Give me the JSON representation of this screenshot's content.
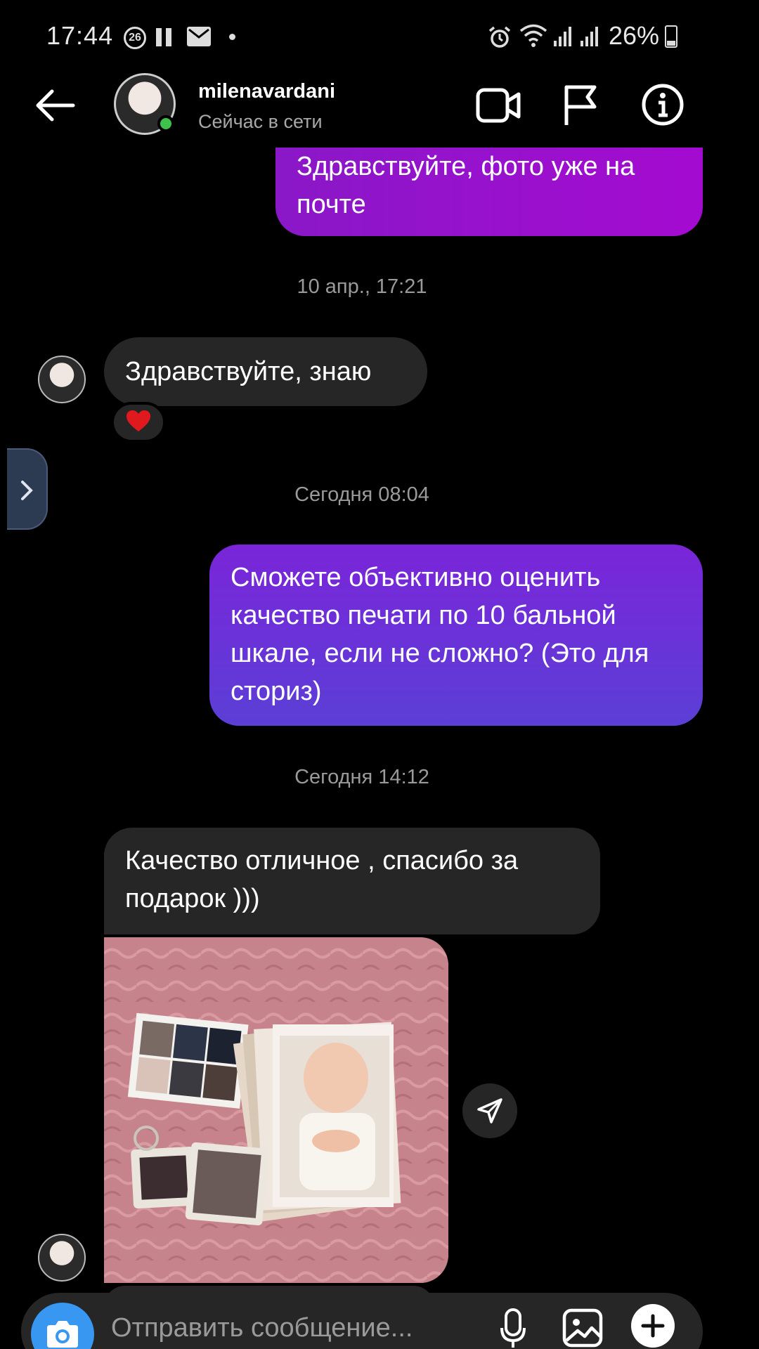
{
  "status_bar": {
    "time": "17:44",
    "notification_count": "26",
    "battery": "26%"
  },
  "header": {
    "contact_name": "milenavardani",
    "contact_status": "Сейчас в сети"
  },
  "messages": {
    "out_1": "Здравствуйте, фото уже на почте",
    "timestamp_1": "10 апр., 17:21",
    "in_1": "Здравствуйте, знаю",
    "in_1_reaction": "❤️",
    "timestamp_2": "Сегодня 08:04",
    "out_2": "Сможете объективно оценить качество печати по 10 бальной шкале, если не сложно? (Это для сториз)",
    "timestamp_3": "Сегодня 14:12",
    "in_2": "Качество отличное , спасибо за подарок )))"
  },
  "composer": {
    "placeholder": "Отправить сообщение..."
  },
  "colors": {
    "outgoing_bubble_top": "#8a18c8",
    "outgoing_bubble_2": "#5b3fd6",
    "incoming_bubble": "#262626",
    "online": "#3ec24b",
    "camera_button": "#3897f0"
  }
}
